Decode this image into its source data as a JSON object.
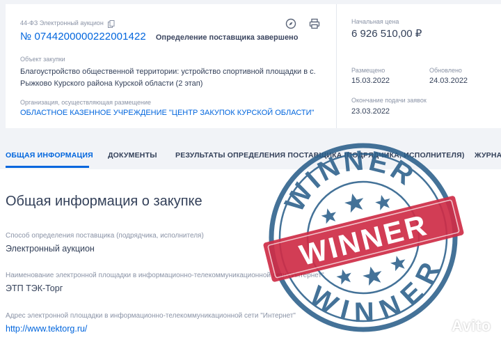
{
  "header": {
    "law": "44-ФЗ Электронный аукцион",
    "reg_number": "№ 0744200000222001422",
    "status": "Определение поставщика завершено",
    "object_label": "Объект закупки",
    "object_text": "Благоустройство общественной территории: устройство спортивной площадки в с. Рыжково Курского района Курской области (2 этап)",
    "org_label": "Организация, осуществляющая размещение",
    "org_text": "ОБЛАСТНОЕ КАЗЕННОЕ УЧРЕЖДЕНИЕ \"ЦЕНТР ЗАКУПОК КУРСКОЙ ОБЛАСТИ\"",
    "price_label": "Начальная цена",
    "price": "6 926 510,00 ₽",
    "published_label": "Размещено",
    "published": "15.03.2022",
    "updated_label": "Обновлено",
    "updated": "24.03.2022",
    "deadline_label": "Окончание подачи заявок",
    "deadline": "23.03.2022"
  },
  "tabs": [
    {
      "label": "ОБЩАЯ ИНФОРМАЦИЯ",
      "active": true
    },
    {
      "label": "ДОКУМЕНТЫ"
    },
    {
      "label": "РЕЗУЛЬТАТЫ ОПРЕДЕЛЕНИЯ ПОСТАВЩИКА (ПОДРЯДЧИКА, ИСПОЛНИТЕЛЯ)"
    },
    {
      "label": "ЖУРНА"
    }
  ],
  "main": {
    "title": "Общая информация о закупке",
    "fields": [
      {
        "label": "Способ определения поставщика (подрядчика, исполнителя)",
        "value": "Электронный аукцион"
      },
      {
        "label": "Наименование электронной площадки в информационно-телекоммуникационной сети \"Интернет\"",
        "value": "ЭТП ТЭК-Торг"
      },
      {
        "label": "Адрес электронной площадки в информационно-телекоммуникационной сети \"Интернет\"",
        "value": "http://www.tektorg.ru/"
      }
    ]
  },
  "stamp": {
    "top": "WINNER",
    "center": "WINNER",
    "bottom": "WINNER"
  },
  "watermark": "Avito",
  "icons": [
    "copy-icon",
    "compass-icon",
    "print-icon",
    "avito-logo-icon"
  ],
  "colors": {
    "accent": "#0065dd",
    "stamp_red": "#c8102e",
    "stamp_blue": "#2b5f8a"
  }
}
